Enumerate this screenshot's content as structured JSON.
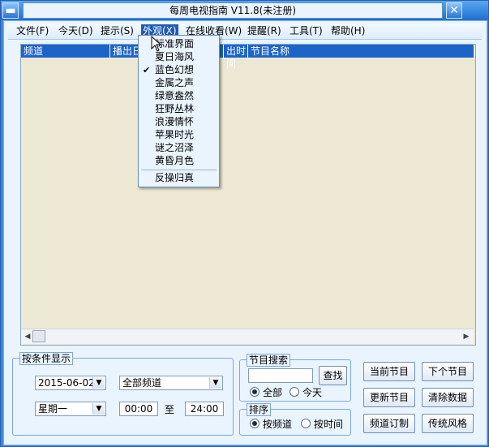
{
  "window": {
    "title": "每周电视指南 V11.8(未注册)"
  },
  "menu": {
    "items": [
      "文件(F)",
      "今天(D)",
      "提示(S)",
      "外观(X)",
      "在线收看(W)",
      "提醒(R)",
      "工具(T)",
      "帮助(H)"
    ],
    "active_index": 3
  },
  "appearance_menu": {
    "items": [
      "标准界面",
      "夏日海风",
      "蓝色幻想",
      "金属之声",
      "绿意盎然",
      "狂野丛林",
      "浪漫情怀",
      "苹果时光",
      "谜之沼泽",
      "黄昏月色"
    ],
    "checked_index": 2,
    "extra_item": "反操归真",
    "check_glyph": "✔"
  },
  "listview": {
    "columns": [
      "频道",
      "播出日",
      "出时间",
      "节目名称"
    ]
  },
  "filter_group": {
    "title": "按条件显示",
    "date_value": "2015-06-02",
    "channel_value": "全部频道",
    "weekday_value": "星期一",
    "time_from": "00:00",
    "to_label": "至",
    "time_to": "24:00"
  },
  "search_group": {
    "title": "节目搜索",
    "input_value": "",
    "search_button": "查找",
    "radio_all": "全部",
    "radio_today": "今天",
    "selected": "all"
  },
  "sort_group": {
    "title": "排序",
    "radio_channel": "按频道",
    "radio_time": "按时间",
    "selected": "channel"
  },
  "buttons": {
    "current_program": "当前节目",
    "next_program": "下个节目",
    "update_program": "更新节目",
    "clear_data": "清除数据",
    "channel_subscribe": "频道订制",
    "classic_style": "传统风格"
  },
  "colors": {
    "header_blue": "#1d64c8",
    "menu_active": "#1f5ab8",
    "list_background": "#ece8d4"
  }
}
